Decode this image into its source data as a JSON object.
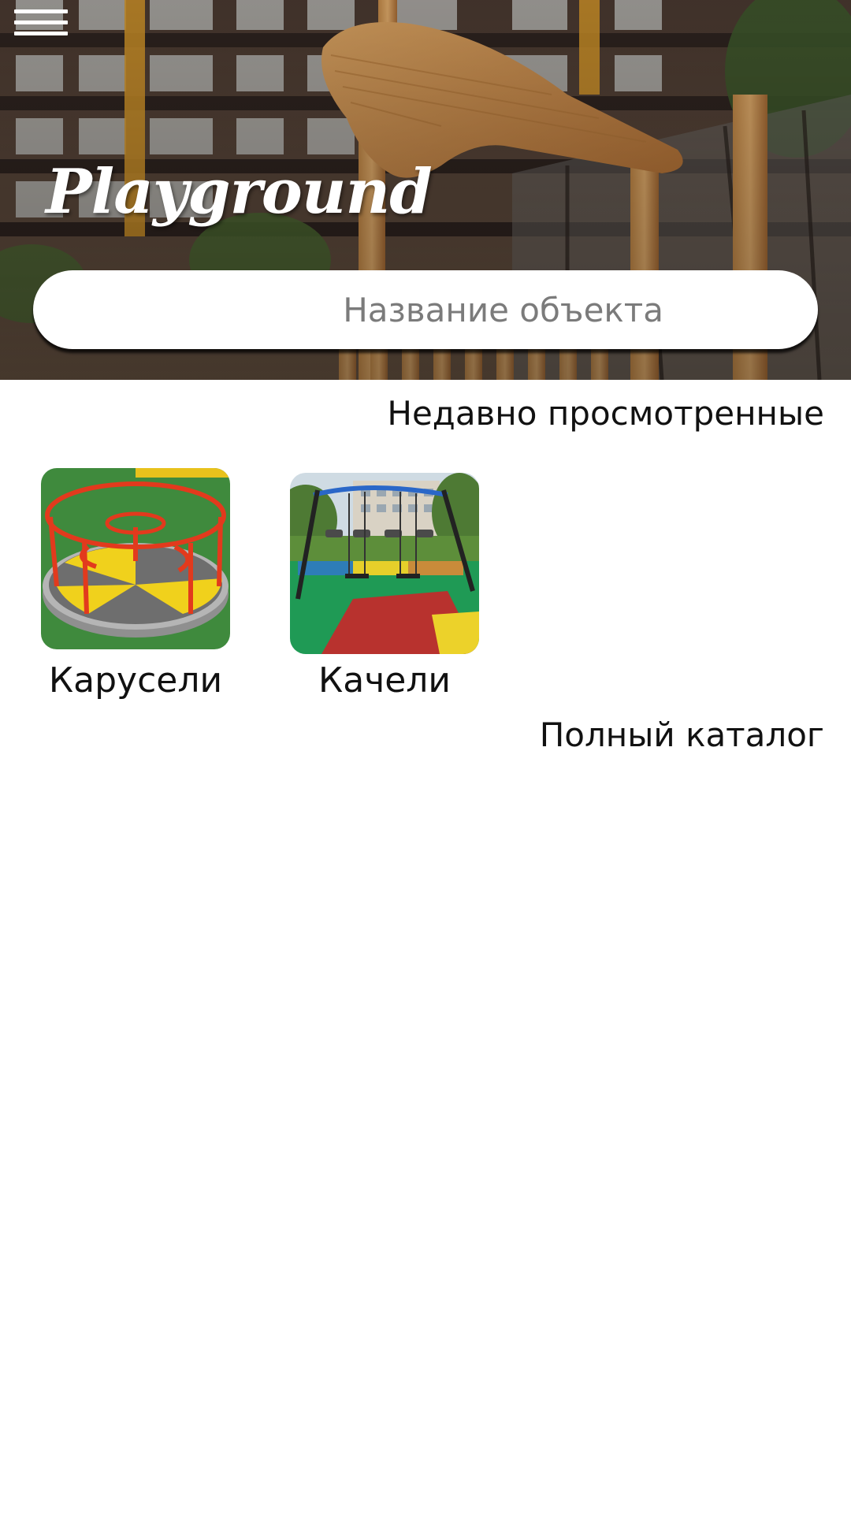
{
  "header": {
    "logo_text": "Playground",
    "menu_icon": "hamburger-menu-icon"
  },
  "search": {
    "placeholder": "Название объекта",
    "value": ""
  },
  "recent": {
    "title": "Недавно просмотренные",
    "items": [
      {
        "label": "Карусели",
        "image": "carousel-photo"
      },
      {
        "label": "Качели",
        "image": "swing-photo"
      }
    ]
  },
  "catalog": {
    "link_label": "Полный каталог"
  },
  "colors": {
    "hero_overlay": "#3a2b22",
    "text_primary": "#111111",
    "placeholder": "#7b7b7b",
    "background": "#ffffff"
  }
}
